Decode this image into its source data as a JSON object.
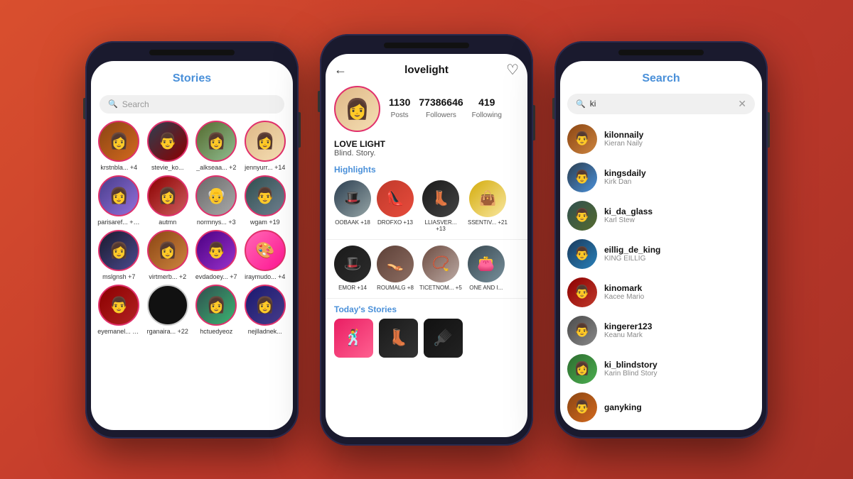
{
  "background": "#d94f2e",
  "phones": {
    "left": {
      "title": "Stories",
      "search_placeholder": "Search",
      "stories": [
        {
          "label": "krstnbla... +4",
          "av": "av-1",
          "emoji": "👩"
        },
        {
          "label": "stevie_ko...",
          "av": "av-2",
          "emoji": "👨"
        },
        {
          "label": "_alkseaa... +2",
          "av": "av-3",
          "emoji": "👩"
        },
        {
          "label": "jennyurr... +14",
          "av": "av-4",
          "emoji": "👩"
        },
        {
          "label": "parisaref... +40",
          "av": "av-5",
          "emoji": "👩"
        },
        {
          "label": "autmn",
          "av": "av-6",
          "emoji": "👩"
        },
        {
          "label": "normnys... +3",
          "av": "av-7",
          "emoji": "👴"
        },
        {
          "label": "wgam +19",
          "av": "av-8",
          "emoji": "👨"
        },
        {
          "label": "mslgnsh +7",
          "av": "av-9",
          "emoji": "👩"
        },
        {
          "label": "virtmerb... +2",
          "av": "av-10",
          "emoji": "👩"
        },
        {
          "label": "evdadoey... +7",
          "av": "av-11",
          "emoji": "👨"
        },
        {
          "label": "iraymudo... +4",
          "av": "av-14",
          "emoji": "🎨"
        },
        {
          "label": "eyemanel... +12",
          "av": "av-15",
          "emoji": "👨"
        },
        {
          "label": "rganaira... +22",
          "av": "av-black",
          "emoji": "⬛"
        },
        {
          "label": "hctuedyeoz",
          "av": "av-16",
          "emoji": "👩"
        },
        {
          "label": "nejlladnek...",
          "av": "av-13",
          "emoji": "👩"
        }
      ]
    },
    "center": {
      "username": "lovelight",
      "stats": {
        "posts": "1130",
        "posts_label": "Posts",
        "followers": "77386646",
        "followers_label": "Followers",
        "following": "419",
        "following_label": "Following"
      },
      "name": "LOVE LIGHT",
      "description": "Blind. Story.",
      "highlights_title": "Highlights",
      "highlights": [
        {
          "label": "OOBAAK +18",
          "color": "h1"
        },
        {
          "label": "DROFXO +13",
          "color": "h2"
        },
        {
          "label": "LLIASVER... +13",
          "color": "h3"
        },
        {
          "label": "SSENTIV... +21",
          "color": "h4"
        }
      ],
      "todays_stories_title": "Today's Stories",
      "todays_stories": [
        {
          "color": "ts1"
        },
        {
          "color": "ts2"
        },
        {
          "color": "ts3"
        }
      ]
    },
    "right": {
      "title": "Search",
      "search_query": "ki",
      "results": [
        {
          "username": "kilonnaily",
          "name": "Kieran Naily",
          "av": "ra1"
        },
        {
          "username": "kingsdaily",
          "name": "Kirk Dan",
          "av": "ra2"
        },
        {
          "username": "ki_da_glass",
          "name": "Karl Stew",
          "av": "ra3"
        },
        {
          "username": "eillig_de_king",
          "name": "KING EILLIG",
          "av": "ra4"
        },
        {
          "username": "kinomark",
          "name": "Kacee Mario",
          "av": "ra5"
        },
        {
          "username": "kingerer123",
          "name": "Keanu Mark",
          "av": "ra6"
        },
        {
          "username": "ki_blindstory",
          "name": "Karin Blind Story",
          "av": "ra7"
        },
        {
          "username": "ganyking",
          "name": "",
          "av": "ra8"
        }
      ]
    }
  }
}
